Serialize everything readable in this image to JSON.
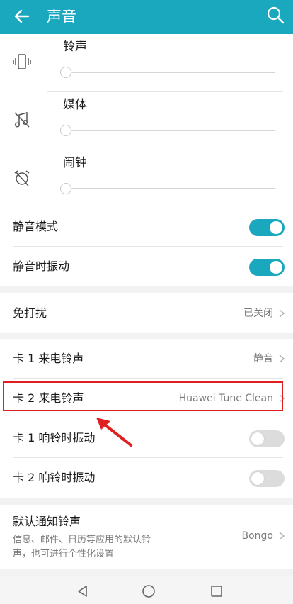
{
  "header": {
    "title": "声音"
  },
  "volumes": [
    {
      "label": "铃声",
      "level": 0.0,
      "icon": "vibrate-icon"
    },
    {
      "label": "媒体",
      "level": 0.0,
      "icon": "music-muted-icon"
    },
    {
      "label": "闹钟",
      "level": 0.0,
      "icon": "alarm-off-icon"
    }
  ],
  "toggles": {
    "silent_mode": {
      "label": "静音模式",
      "on": true
    },
    "vibrate_when_silent": {
      "label": "静音时振动",
      "on": true
    }
  },
  "dnd": {
    "label": "免打扰",
    "value": "已关闭"
  },
  "sim": {
    "sim1_ringtone": {
      "label": "卡 1 来电铃声",
      "value": "静音"
    },
    "sim2_ringtone": {
      "label": "卡 2 来电铃声",
      "value": "Huawei Tune Clean"
    },
    "sim1_vibrate": {
      "label": "卡 1 响铃时振动",
      "on": false
    },
    "sim2_vibrate": {
      "label": "卡 2 响铃时振动",
      "on": false
    }
  },
  "notification": {
    "label": "默认通知铃声",
    "desc_line1": "信息、邮件、日历等应用的默认铃",
    "desc_line2": "声，也可进行个性化设置",
    "value": "Bongo"
  },
  "colors": {
    "accent": "#1aa8bf",
    "highlight": "#e02020"
  }
}
